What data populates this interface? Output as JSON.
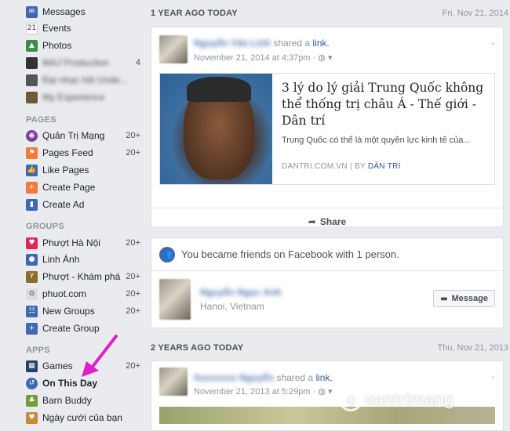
{
  "sidebar": {
    "top_items": [
      {
        "label": "Messages",
        "icon": "messages-icon",
        "color": "#4267b2",
        "count": ""
      },
      {
        "label": "Events",
        "icon": "calendar-icon",
        "color": "#ffffff",
        "count": ""
      },
      {
        "label": "Photos",
        "icon": "photos-icon",
        "color": "#3b8c4a",
        "count": ""
      },
      {
        "label": "MAJ Production",
        "icon": "group-thumbnail-icon",
        "color": "#333333",
        "count": "4"
      },
      {
        "label": "Đại nhạc hội Unde...",
        "icon": "group-thumbnail-icon",
        "color": "#555555",
        "count": ""
      },
      {
        "label": "My Experience",
        "icon": "group-thumbnail-icon",
        "color": "#6b5b3a",
        "count": ""
      }
    ],
    "pages_header": "PAGES",
    "pages": [
      {
        "label": "Quản Trị Mạng",
        "icon": "page-logo-icon",
        "color": "#7b3fa0",
        "count": "20+"
      },
      {
        "label": "Pages Feed",
        "icon": "pages-feed-icon",
        "color": "#f5793a",
        "count": "20+"
      },
      {
        "label": "Like Pages",
        "icon": "thumbs-up-icon",
        "color": "#4267b2",
        "count": ""
      },
      {
        "label": "Create Page",
        "icon": "create-page-icon",
        "color": "#f5793a",
        "count": ""
      },
      {
        "label": "Create Ad",
        "icon": "create-ad-icon",
        "color": "#4267b2",
        "count": ""
      }
    ],
    "groups_header": "GROUPS",
    "groups": [
      {
        "label": "Phượt Hà Nội",
        "icon": "heart-group-icon",
        "color": "#e0245e",
        "count": "20+"
      },
      {
        "label": "Linh Ánh",
        "icon": "group-icon",
        "color": "#4267b2",
        "count": ""
      },
      {
        "label": "Phượt - Khám phá",
        "icon": "trophy-icon",
        "color": "#8b6d2b",
        "count": "20+"
      },
      {
        "label": "phuot.com",
        "icon": "group-logo-icon",
        "color": "#cccccc",
        "count": "20+"
      },
      {
        "label": "New Groups",
        "icon": "new-groups-icon",
        "color": "#4267b2",
        "count": "20+"
      },
      {
        "label": "Create Group",
        "icon": "create-group-icon",
        "color": "#4267b2",
        "count": ""
      }
    ],
    "apps_header": "APPS",
    "apps": [
      {
        "label": "Games",
        "icon": "games-icon",
        "color": "#2c3e70",
        "count": "20+"
      },
      {
        "label": "On This Day",
        "icon": "on-this-day-icon",
        "color": "#4267b2",
        "count": ""
      },
      {
        "label": "Barn Buddy",
        "icon": "barn-buddy-icon",
        "color": "#7a9a3a",
        "count": ""
      },
      {
        "label": "Ngày cưới của bạn",
        "icon": "wedding-icon",
        "color": "#c58b3a",
        "count": ""
      }
    ]
  },
  "sections": [
    {
      "title": "1 YEAR AGO TODAY",
      "date": "Fri, Nov 21, 2014",
      "post": {
        "author": "Nguyễn Văn Linh",
        "action": "shared a",
        "link_word": "link.",
        "meta": "November 21, 2014 at 4:37pm · ",
        "link_title": "3 lý do lý giải Trung Quốc không thể thống trị châu Á - Thế giới - Dân trí",
        "link_desc": "Trung Quốc có thể là một quyền lực kinh tế của...",
        "link_source": "DANTRI.COM.VN",
        "link_by_prefix": " | BY ",
        "link_by": "DÂN TRÍ",
        "share": "Share"
      },
      "friends": {
        "text": "You became friends on Facebook with 1 person.",
        "friend_name": "Nguyễn Ngọc Anh",
        "friend_location": "Hanoi, Vietnam",
        "message_button": "Message"
      }
    },
    {
      "title": "2 YEARS AGO TODAY",
      "date": "Thu, Nov 21, 2013",
      "post": {
        "author": "Xxxxxxxx Nguyễn",
        "action": "shared a",
        "link_word": "link.",
        "meta": "November 21, 2013 at 5:29pm · "
      }
    }
  ],
  "watermark": {
    "text": "uantrimang"
  }
}
